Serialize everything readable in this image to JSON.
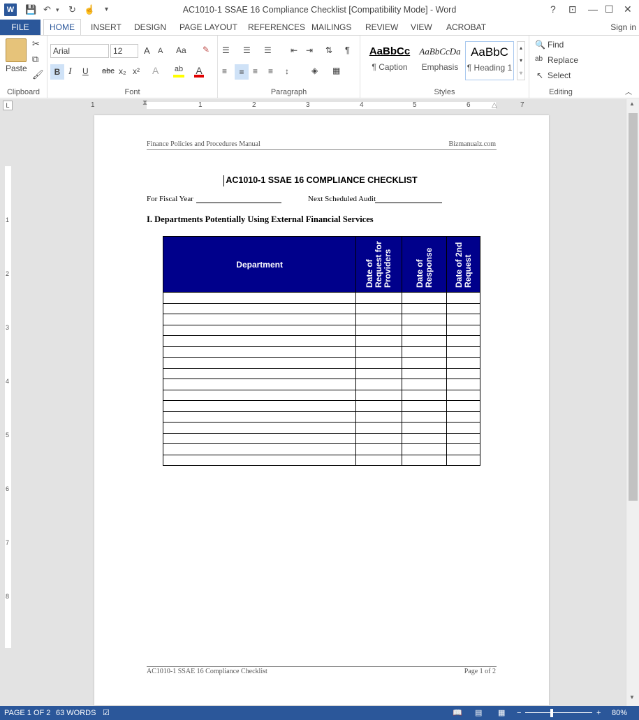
{
  "app": {
    "title": "AC1010-1 SSAE 16 Compliance Checklist [Compatibility Mode] - Word",
    "logo": "W"
  },
  "window_controls": {
    "help": "?",
    "ribbon_display": "⊡",
    "minimize": "—",
    "maximize": "☐",
    "close": "✕"
  },
  "quick_access": {
    "save": "save-icon",
    "undo": "undo-icon",
    "redo": "redo-icon",
    "touch": "touch-mode-icon",
    "customize": "▾"
  },
  "tabs": {
    "file": "FILE",
    "items": [
      "HOME",
      "INSERT",
      "DESIGN",
      "PAGE LAYOUT",
      "REFERENCES",
      "MAILINGS",
      "REVIEW",
      "VIEW",
      "ACROBAT"
    ],
    "active": "HOME",
    "signin": "Sign in"
  },
  "ribbon": {
    "clipboard": {
      "label": "Clipboard",
      "paste": "Paste"
    },
    "font": {
      "label": "Font",
      "name": "Arial",
      "size": "12",
      "grow": "A",
      "shrink": "A",
      "case": "Aa",
      "bold": "B",
      "italic": "I",
      "underline": "U",
      "strike": "abc",
      "sub": "x₂",
      "sup": "x²"
    },
    "paragraph": {
      "label": "Paragraph",
      "pilcrow": "¶"
    },
    "styles": {
      "label": "Styles",
      "items": [
        {
          "preview": "AaBbCc",
          "name": "¶ Caption"
        },
        {
          "preview": "AaBbCcDa",
          "name": "Emphasis"
        },
        {
          "preview": "AaBbC",
          "name": "¶ Heading 1"
        }
      ]
    },
    "editing": {
      "label": "Editing",
      "find": "Find",
      "replace": "Replace",
      "select": "Select"
    }
  },
  "ruler": {
    "numbers": [
      "1",
      "1",
      "2",
      "3",
      "4",
      "5",
      "6",
      "7"
    ],
    "vnumbers": [
      "1",
      "2",
      "3",
      "4",
      "5",
      "6",
      "7",
      "8"
    ]
  },
  "document": {
    "header_left": "Finance Policies and Procedures Manual",
    "header_right": "Bizmanualz.com",
    "title": "AC1010-1 SSAE 16 COMPLIANCE CHECKLIST",
    "fiscal_year_label": "For Fiscal Year",
    "next_audit_label": "Next Scheduled Audit",
    "section_heading": "I. Departments Potentially Using External Financial Services",
    "table": {
      "headers": [
        "Department",
        "Date of Request for Providers",
        "Date of Response",
        "Date of 2nd Request"
      ],
      "header_accent": "#00008b",
      "empty_rows": 16
    },
    "footer_left": "AC1010-1 SSAE 16 Compliance Checklist",
    "footer_right": "Page 1 of 2"
  },
  "status": {
    "page": "PAGE 1 OF 2",
    "words": "63 WORDS",
    "zoom": "80%",
    "accent": "#2b579a"
  }
}
